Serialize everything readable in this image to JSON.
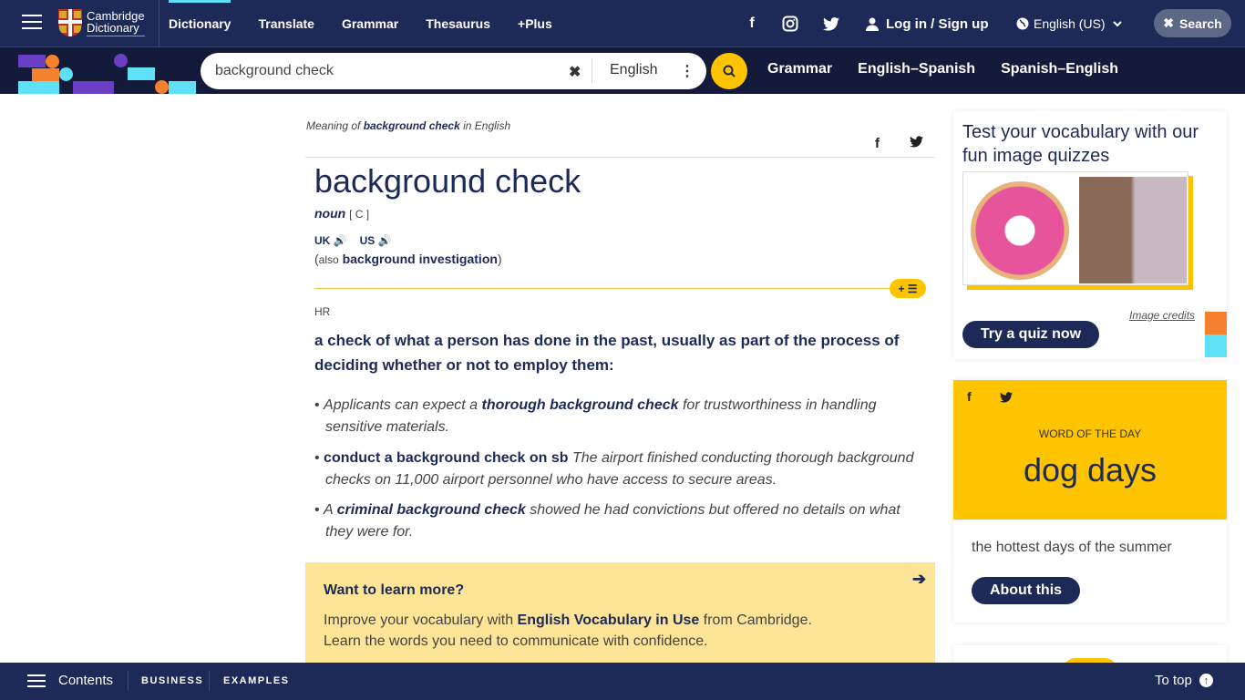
{
  "header": {
    "logo_line1": "Cambridge",
    "logo_line2": "Dictionary",
    "nav": [
      "Dictionary",
      "Translate",
      "Grammar",
      "Thesaurus",
      "+Plus"
    ],
    "social": {
      "facebook": "f",
      "instagram": "◎",
      "twitter": "🐦"
    },
    "login_label": "Log in / Sign up",
    "language_label": "English (US)",
    "search_toggle_label": "Search"
  },
  "search": {
    "value": "background check",
    "dictionary_selected": "English",
    "subnav": [
      "Grammar",
      "English–Spanish",
      "Spanish–English"
    ]
  },
  "entry": {
    "meaning_prefix": "Meaning of",
    "meaning_word": "background check",
    "meaning_suffix": "in English",
    "headword": "background check",
    "pos": "noun",
    "grammar": "[ C ]",
    "pron_uk": "UK",
    "pron_us": "US",
    "also_label": "also",
    "also_word": "background investigation",
    "domain": "HR",
    "definition": "a check of what a person has done in the past, usually as part of the process of deciding whether or not to employ them:",
    "examples": [
      {
        "pre": "Applicants can expect a",
        "bold": "thorough background check",
        "post": "for trustworthiness in handling sensitive materials."
      },
      {
        "phrase": "conduct a background check on sb",
        "text": "The airport finished conducting thorough background checks on 11,000 airport personnel who have access to secure areas."
      },
      {
        "pre": "A",
        "bold": "criminal background check",
        "post": "showed he had convictions but offered no details on what they were for."
      }
    ],
    "add_to_list": "+ ☰"
  },
  "learn_more": {
    "title": "Want to learn more?",
    "line1_pre": "Improve your vocabulary with",
    "line1_bold": "English Vocabulary in Use",
    "line1_post": "from Cambridge.",
    "line2": "Learn the words you need to communicate with confidence."
  },
  "quiz": {
    "title": "Test your vocabulary with our fun image quizzes",
    "credits": "Image credits",
    "button": "Try a quiz now"
  },
  "wotd": {
    "label": "WORD OF THE DAY",
    "word": "dog days",
    "definition": "the hottest days of the summer",
    "button": "About this"
  },
  "bottom": {
    "contents": "Contents",
    "links": [
      "BUSINESS",
      "EXAMPLES"
    ],
    "to_top": "To top"
  },
  "colors": {
    "navy": "#1d2a57",
    "yellow": "#fec400",
    "cyan": "#5ee0f7",
    "orange": "#f5802e",
    "purple": "#6a3fc6"
  }
}
